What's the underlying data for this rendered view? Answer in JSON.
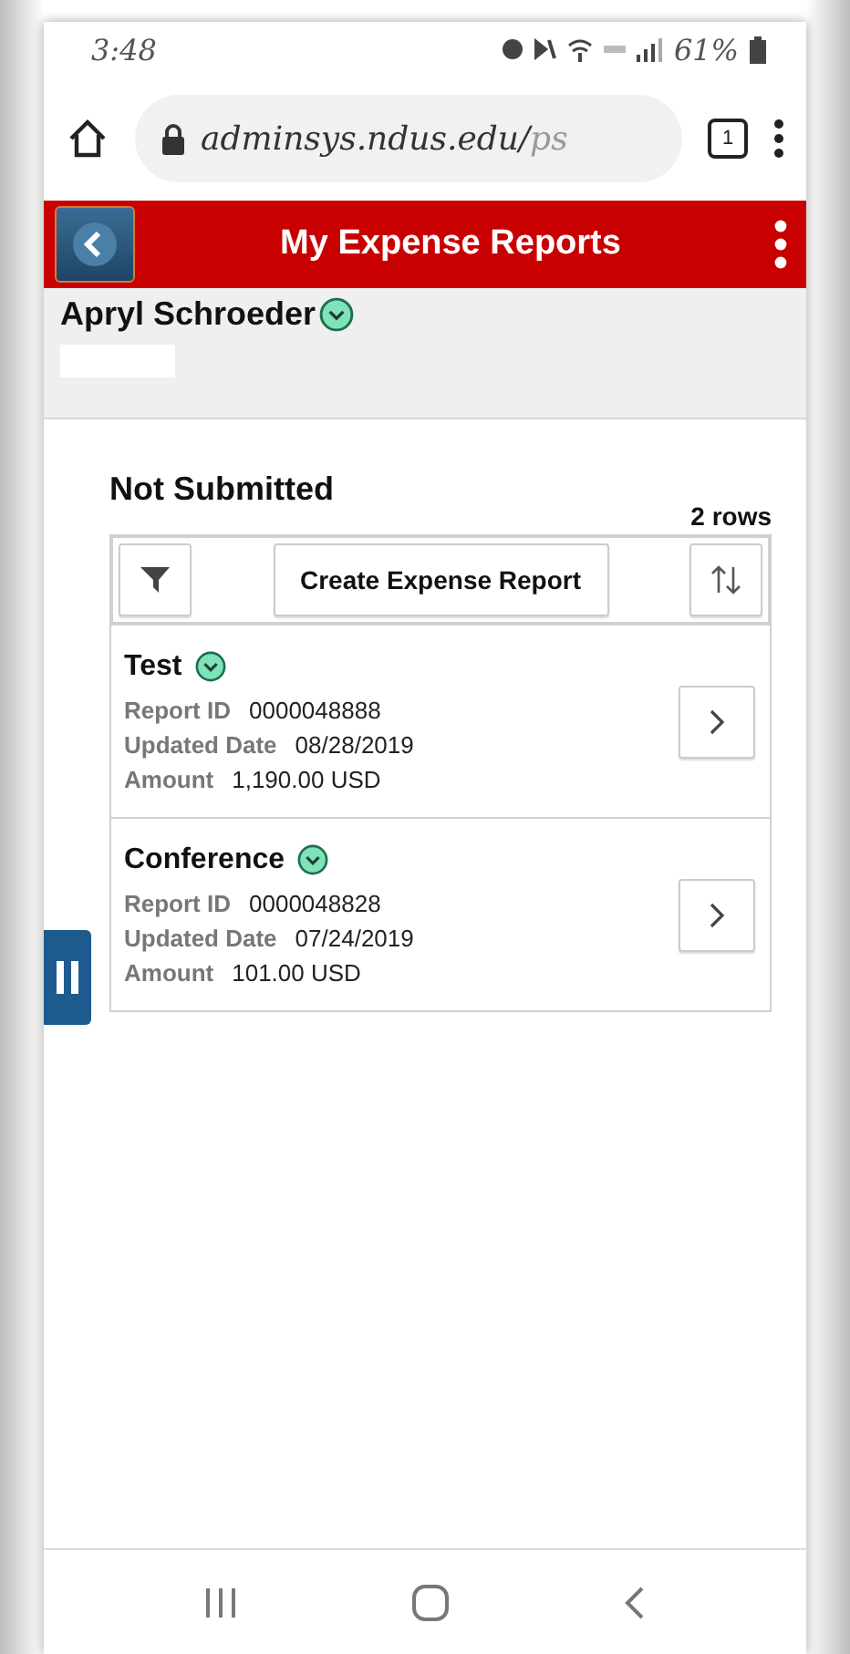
{
  "status_bar": {
    "time": "3:48",
    "battery": "61%"
  },
  "browser": {
    "url": "adminsys.ndus.edu/",
    "url_faded": "ps",
    "tab_count": "1"
  },
  "header": {
    "title": "My Expense Reports"
  },
  "user": {
    "name": "Apryl Schroeder"
  },
  "section": {
    "title": "Not Submitted",
    "row_count": "2 rows",
    "create_button": "Create Expense Report"
  },
  "reports": [
    {
      "title": "Test",
      "fields": [
        {
          "label": "Report ID",
          "value": "0000048888"
        },
        {
          "label": "Updated Date",
          "value": "08/28/2019"
        },
        {
          "label": "Amount",
          "value": "1,190.00 USD"
        }
      ]
    },
    {
      "title": "Conference",
      "fields": [
        {
          "label": "Report ID",
          "value": "0000048828"
        },
        {
          "label": "Updated Date",
          "value": "07/24/2019"
        },
        {
          "label": "Amount",
          "value": "101.00 USD"
        }
      ]
    }
  ]
}
